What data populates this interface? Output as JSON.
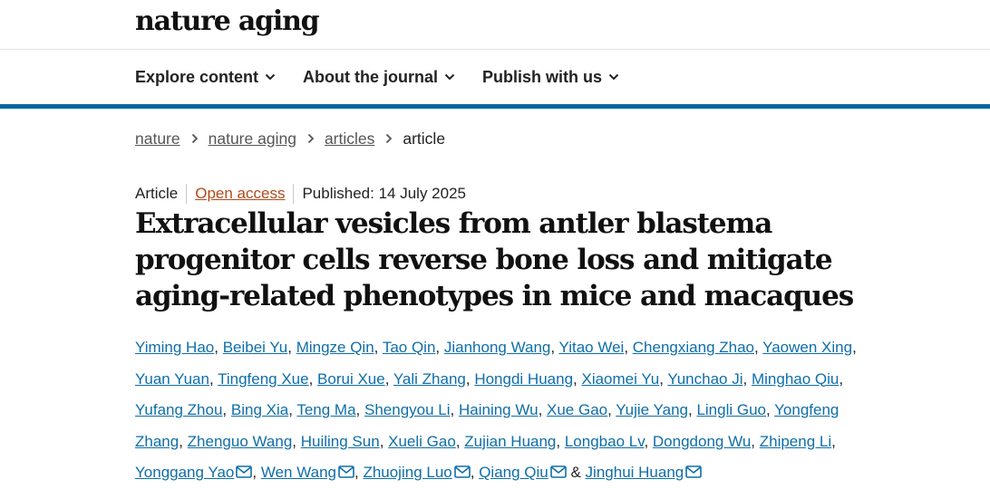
{
  "header": {
    "logo": "nature aging"
  },
  "nav": [
    {
      "label": "Explore content"
    },
    {
      "label": "About the journal"
    },
    {
      "label": "Publish with us"
    }
  ],
  "breadcrumb": [
    {
      "label": "nature"
    },
    {
      "label": "nature aging"
    },
    {
      "label": "articles"
    },
    {
      "label": "article"
    }
  ],
  "article": {
    "type": "Article",
    "access": "Open access",
    "published": "Published: 14 July 2025",
    "title": "Extracellular vesicles from antler blastema progenitor cells reverse bone loss and mitigate aging-related phenotypes in mice and macaques",
    "authors": [
      "Yiming Hao",
      "Beibei Yu",
      "Mingze Qin",
      "Tao Qin",
      "Jianhong Wang",
      "Yitao Wei",
      "Chengxiang Zhao",
      "Yaowen Xing",
      "Yuan Yuan",
      "Tingfeng Xue",
      "Borui Xue",
      "Yali Zhang",
      "Hongdi Huang",
      "Xiaomei Yu",
      "Yunchao Ji",
      "Minghao Qiu",
      "Yufang Zhou",
      "Bing Xia",
      "Teng Ma",
      "Shengyou Li",
      "Haining Wu",
      "Xue Gao",
      "Yujie Yang",
      "Lingli Guo",
      "Yongfeng Zhang",
      "Zhenguo Wang",
      "Huiling Sun",
      "Xueli Gao",
      "Zujian Huang",
      "Longbao Lv",
      "Dongdong Wu",
      "Zhipeng Li",
      "Yonggang Yao",
      "Wen Wang",
      "Zhuojing Luo",
      "Qiang Qiu",
      "Jinghui Huang"
    ],
    "corresponding": [
      "Yonggang Yao",
      "Wen Wang",
      "Zhuojing Luo",
      "Qiang Qiu",
      "Jinghui Huang"
    ],
    "separator": ", ",
    "last_separator": " & "
  },
  "icons": {
    "nav_dropdown": "chevron-down-icon",
    "breadcrumb_sep": "chevron-right-icon",
    "corresponding": "envelope-icon"
  },
  "colors": {
    "link": "#0f6ea8",
    "open_access": "#b04a1b",
    "accent_rule": "#0468a0"
  }
}
